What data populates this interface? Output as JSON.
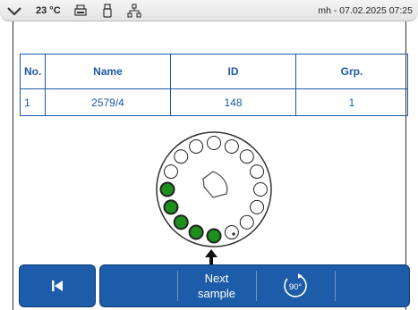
{
  "status_bar": {
    "temperature": "23 °C",
    "user_datetime": "mh - 07.02.2025 07:25",
    "icons": [
      "chevron-down-icon",
      "printer-icon",
      "usb-icon",
      "network-icon"
    ]
  },
  "table": {
    "headers": [
      "No.",
      "Name",
      "ID",
      "Grp."
    ],
    "rows": [
      [
        "1",
        "2579/4",
        "148",
        "1"
      ]
    ]
  },
  "carousel": {
    "positions_total": 16,
    "filled_positions": 5,
    "filled_color": "#1d8f1d",
    "empty_color": "#ffffff"
  },
  "toolbar": {
    "back_icon": "skip-back-icon",
    "next_line1": "Next",
    "next_line2": "sample",
    "rotate_label": "90°"
  },
  "colors": {
    "accent": "#1c5ca8",
    "table_text": "#1c5aa6"
  }
}
